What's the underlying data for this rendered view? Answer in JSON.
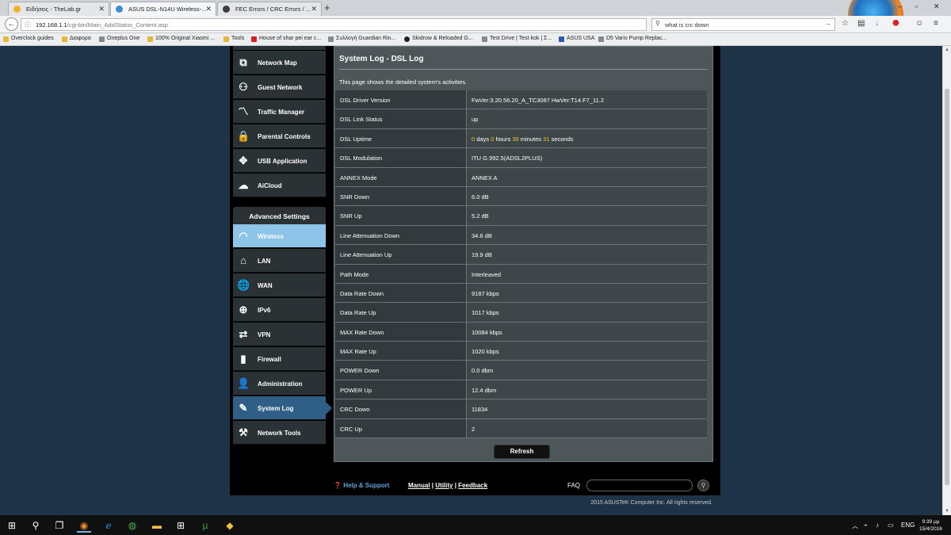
{
  "browser": {
    "tabs": [
      {
        "title": "Ειδήσεις - TheLab.gr",
        "active": false
      },
      {
        "title": "ASUS DSL-N14U Wireless-...",
        "active": true
      },
      {
        "title": "FEC Errors / CRC Errors / ...",
        "active": false
      }
    ],
    "new_tab": "+",
    "url_host": "192.168.1.1",
    "url_path": "/cgi-bin/Main_AdslStatus_Content.asp",
    "search_value": "what is crc down",
    "bookmarks": [
      "Overclock guides",
      "Διαφορα",
      "Oneplus One",
      "100% Original Xiaomi ...",
      "Tools",
      "House of shar pei ear c...",
      "Συλλογή Guardian Rin...",
      "Skidrow & Reloaded G...",
      "Test Drive | Test kok | Σ...",
      "ASUS USA",
      "D5 Vario Pump Replac..."
    ]
  },
  "router": {
    "general_menu": [
      {
        "label": "Network Map",
        "icon": "network-map-icon"
      },
      {
        "label": "Guest Network",
        "icon": "guest-network-icon"
      },
      {
        "label": "Traffic Manager",
        "icon": "traffic-manager-icon"
      },
      {
        "label": "Parental Controls",
        "icon": "parental-controls-icon"
      },
      {
        "label": "USB Application",
        "icon": "usb-application-icon"
      },
      {
        "label": "AiCloud",
        "icon": "aicloud-icon"
      }
    ],
    "advanced_header": "Advanced Settings",
    "advanced_menu": [
      {
        "label": "Wireless",
        "icon": "wireless-icon"
      },
      {
        "label": "LAN",
        "icon": "lan-icon"
      },
      {
        "label": "WAN",
        "icon": "wan-icon"
      },
      {
        "label": "IPv6",
        "icon": "ipv6-icon"
      },
      {
        "label": "VPN",
        "icon": "vpn-icon"
      },
      {
        "label": "Firewall",
        "icon": "firewall-icon"
      },
      {
        "label": "Administration",
        "icon": "administration-icon"
      },
      {
        "label": "System Log",
        "icon": "system-log-icon"
      },
      {
        "label": "Network Tools",
        "icon": "network-tools-icon"
      }
    ],
    "page_title": "System Log - DSL Log",
    "description": "This page shows the detailed system's activities.",
    "status_rows": [
      {
        "key": "DSL Driver Version",
        "value": "FwVer:3.20.56.20_A_TC3087 HwVer:T14.F7_11.2"
      },
      {
        "key": "DSL Link Status",
        "value": "up"
      },
      {
        "key": "DSL Uptime",
        "value": ""
      },
      {
        "key": "DSL Modulation",
        "value": "ITU G.992.5(ADSL2PLUS)"
      },
      {
        "key": "ANNEX Mode",
        "value": "ANNEX A"
      },
      {
        "key": "SNR Down",
        "value": "6.0 dB"
      },
      {
        "key": "SNR Up",
        "value": "5.2 dB"
      },
      {
        "key": "Line Attenuation Down",
        "value": "34.6 dB"
      },
      {
        "key": "Line Attenuation Up",
        "value": "19.9 dB"
      },
      {
        "key": "Path Mode",
        "value": "Interleaved"
      },
      {
        "key": "Data Rate Down",
        "value": "9187 kbps"
      },
      {
        "key": "Data Rate Up",
        "value": "1017 kbps"
      },
      {
        "key": "MAX Rate Down",
        "value": "10084 kbps"
      },
      {
        "key": "MAX Rate Up",
        "value": "1020 kbps"
      },
      {
        "key": "POWER Down",
        "value": "0.0 dbm"
      },
      {
        "key": "POWER Up",
        "value": "12.4 dbm"
      },
      {
        "key": "CRC Down",
        "value": "11834"
      },
      {
        "key": "CRC Up",
        "value": "2"
      }
    ],
    "uptime": {
      "days": "0",
      "days_label": "days",
      "hours": "0",
      "hours_label": "hours",
      "minutes": "39",
      "minutes_label": "minutes",
      "seconds": "31",
      "seconds_label": "seconds"
    },
    "refresh_label": "Refresh",
    "help_support": "Help & Support",
    "footer_links": [
      "Manual",
      "Utility",
      "Feedback"
    ],
    "faq_label": "FAQ",
    "copyright": "2015 ASUSTeK Computer Inc. All rights reserved."
  },
  "taskbar": {
    "language": "ENG",
    "time": "9:39 μμ",
    "date": "15/4/2016"
  },
  "colors": {
    "highlight": "#f5c518",
    "active_menu": "#8ec4e7",
    "help_link": "#5aa3d8"
  }
}
